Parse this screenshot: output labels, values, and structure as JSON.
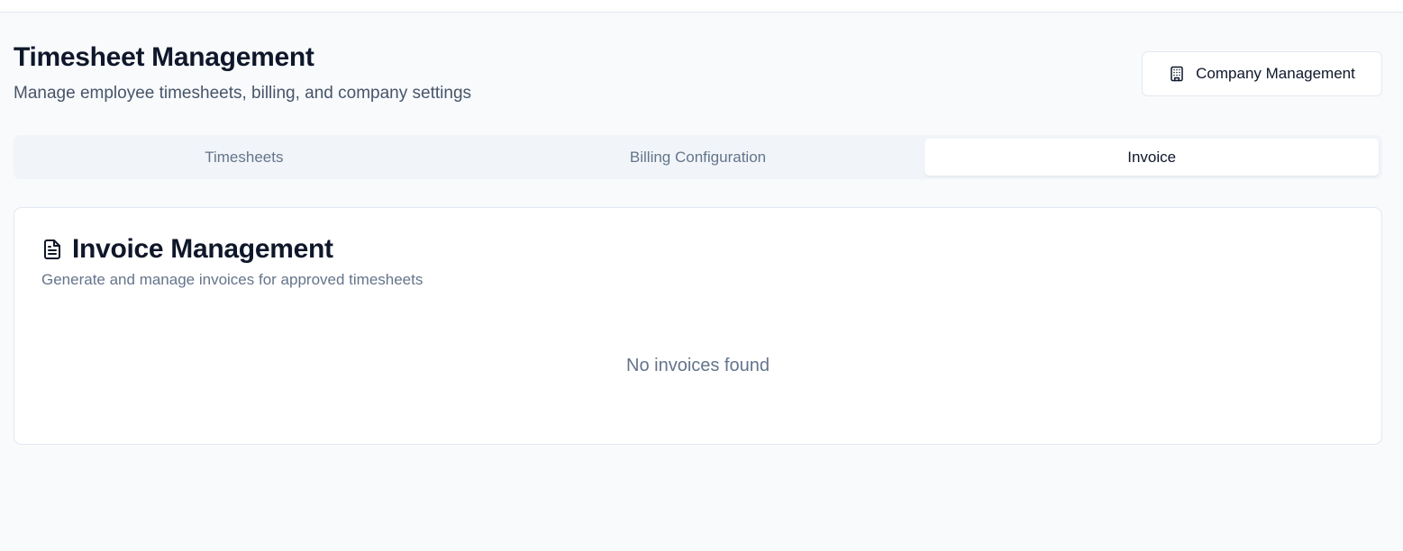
{
  "header": {
    "title": "Timesheet Management",
    "subtitle": "Manage employee timesheets, billing, and company settings",
    "company_button": {
      "label": "Company Management",
      "icon": "building-icon"
    }
  },
  "tabs": [
    {
      "label": "Timesheets",
      "active": false
    },
    {
      "label": "Billing Configuration",
      "active": false
    },
    {
      "label": "Invoice",
      "active": true
    }
  ],
  "invoice_card": {
    "icon": "file-text-icon",
    "title": "Invoice Management",
    "subtitle": "Generate and manage invoices for approved timesheets",
    "empty_message": "No invoices found"
  },
  "colors": {
    "background": "#f8fafc",
    "text_primary": "#0f172a",
    "text_muted": "#64748b",
    "border": "#e2e8f0",
    "tab_bar": "#f1f5f9"
  }
}
